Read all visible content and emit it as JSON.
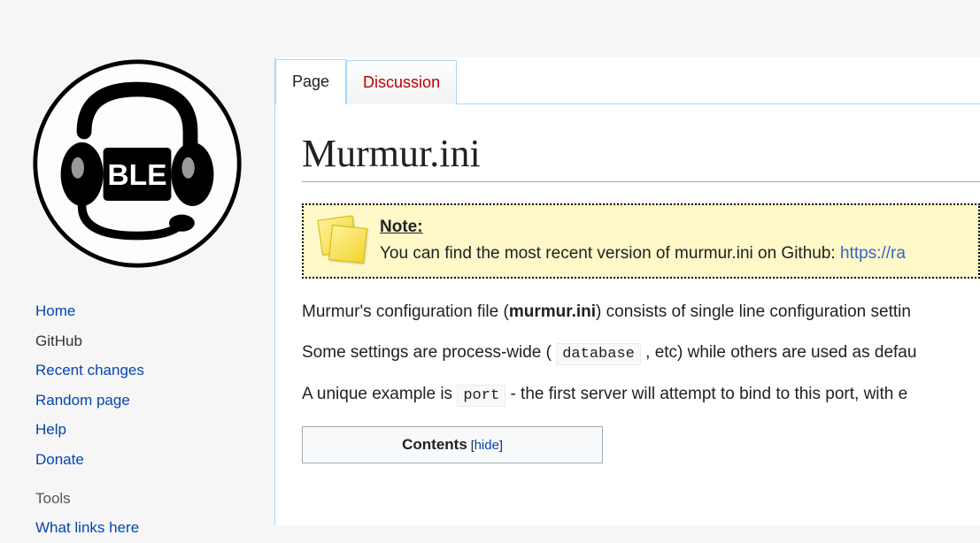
{
  "sidebar": {
    "items": [
      {
        "label": "Home",
        "current": false
      },
      {
        "label": "GitHub",
        "current": true
      },
      {
        "label": "Recent changes",
        "current": false
      },
      {
        "label": "Random page",
        "current": false
      },
      {
        "label": "Help",
        "current": false
      },
      {
        "label": "Donate",
        "current": false
      }
    ],
    "tools_heading": "Tools",
    "tools": [
      {
        "label": "What links here"
      }
    ]
  },
  "tabs": {
    "page": "Page",
    "discussion": "Discussion"
  },
  "page_title": "Murmur.ini",
  "note": {
    "label": "Note:",
    "text_before_link": "You can find the most recent version of murmur.ini on Github: ",
    "link": "https://ra"
  },
  "paragraphs": {
    "p1_a": "Murmur's configuration file (",
    "p1_b": "murmur.ini",
    "p1_c": ") consists of single line configuration settin",
    "p2_a": "Some settings are process-wide ( ",
    "p2_code": "database",
    "p2_b": " , etc) while others are used as defau",
    "p3_a": "A unique example is ",
    "p3_code": "port",
    "p3_b": " - the first server will attempt to bind to this port, with e"
  },
  "toc": {
    "title": "Contents",
    "toggle": "hide"
  }
}
